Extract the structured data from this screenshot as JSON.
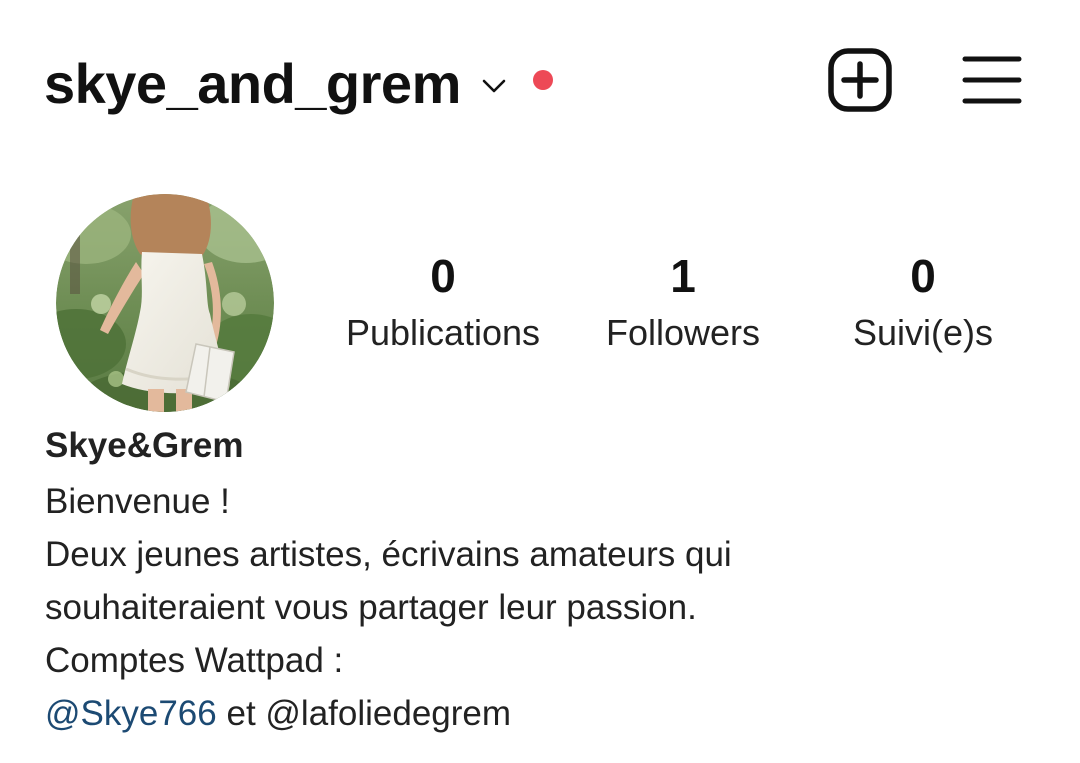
{
  "header": {
    "username": "skye_and_grem",
    "notification_dot_color": "#ed4956",
    "icons": {
      "switcher": "chevron-down-icon",
      "new_post": "plus-square-icon",
      "menu": "hamburger-menu-icon"
    }
  },
  "profile": {
    "avatar_description_icon": "avatar",
    "stats": [
      {
        "count": "0",
        "label": "Publications"
      },
      {
        "count": "1",
        "label": "Followers"
      },
      {
        "count": "0",
        "label": "Suivi(e)s"
      }
    ]
  },
  "bio": {
    "display_name": "Skye&Grem",
    "line1": "Bienvenue !",
    "line2": "Deux jeunes artistes, écrivains amateurs qui",
    "line3": "souhaiteraient vous partager leur passion.",
    "line4": "Comptes Wattpad :",
    "mention1": "@Skye766",
    "connector": " et ",
    "mention2": "@lafoliedegrem",
    "mention1_color": "#1c4a73",
    "mention2_color": "#222222"
  },
  "colors": {
    "text": "#111111",
    "background": "#ffffff",
    "link": "#1c4a73",
    "alert": "#ed4956"
  }
}
